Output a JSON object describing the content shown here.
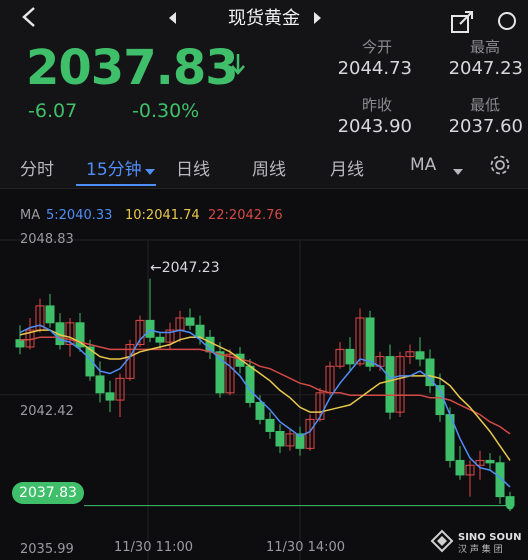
{
  "header": {
    "title": "现货黄金"
  },
  "quote": {
    "last": "2037.83",
    "direction": "down",
    "change": "-6.07",
    "change_pct": "-0.30%",
    "open_label": "今开",
    "open": "2044.73",
    "high_label": "最高",
    "high": "2047.23",
    "prev_close_label": "昨收",
    "prev_close": "2043.90",
    "low_label": "最低",
    "low": "2037.60"
  },
  "tabs": [
    {
      "label": "分时"
    },
    {
      "label": "15分钟"
    },
    {
      "label": "日线"
    },
    {
      "label": "周线"
    },
    {
      "label": "月线"
    },
    {
      "label": "MA"
    }
  ],
  "indicators": {
    "ma": "MA",
    "ma5": "5:2040.33",
    "ma10": "10:2041.74",
    "ma22": "22:2042.76"
  },
  "colors": {
    "up": "#3fbf6a",
    "down": "#e04848",
    "accent": "#4f8ef5",
    "ma5": "#4f8ef5",
    "ma10": "#e8c84a",
    "ma22": "#d24a46"
  },
  "chart_data": {
    "type": "candlestick",
    "y_ticks": [
      "2048.83",
      "2042.42",
      "2035.99"
    ],
    "x_ticks": [
      "11/30 11:00",
      "11/30 14:00"
    ],
    "ylim": [
      2035.99,
      2048.83
    ],
    "high_annotation": "←2047.23",
    "current_price_label": "2037.83",
    "candles": [
      [
        2044.7,
        2045.3,
        2044.1,
        2044.4
      ],
      [
        2044.4,
        2045.6,
        2044.3,
        2045.1
      ],
      [
        2045.1,
        2046.4,
        2045.0,
        2046.1
      ],
      [
        2046.1,
        2046.6,
        2045.2,
        2045.4
      ],
      [
        2045.4,
        2045.8,
        2044.3,
        2044.5
      ],
      [
        2044.5,
        2045.6,
        2044.0,
        2045.4
      ],
      [
        2045.4,
        2045.8,
        2044.2,
        2044.4
      ],
      [
        2044.4,
        2044.7,
        2043.0,
        2043.2
      ],
      [
        2043.2,
        2043.8,
        2042.1,
        2042.5
      ],
      [
        2042.5,
        2043.0,
        2041.7,
        2042.2
      ],
      [
        2042.2,
        2043.3,
        2041.5,
        2043.1
      ],
      [
        2043.1,
        2044.7,
        2043.0,
        2044.5
      ],
      [
        2044.5,
        2045.7,
        2044.4,
        2045.5
      ],
      [
        2045.5,
        2047.23,
        2044.6,
        2044.8
      ],
      [
        2044.8,
        2045.0,
        2044.3,
        2044.6
      ],
      [
        2044.6,
        2045.4,
        2044.3,
        2045.1
      ],
      [
        2045.1,
        2045.9,
        2044.6,
        2045.6
      ],
      [
        2045.6,
        2046.0,
        2045.1,
        2045.3
      ],
      [
        2045.3,
        2045.7,
        2044.5,
        2044.8
      ],
      [
        2044.8,
        2045.1,
        2043.9,
        2044.2
      ],
      [
        2044.2,
        2044.6,
        2042.3,
        2042.5
      ],
      [
        2042.5,
        2044.3,
        2042.4,
        2044.1
      ],
      [
        2044.1,
        2044.4,
        2043.3,
        2043.6
      ],
      [
        2043.6,
        2043.9,
        2041.9,
        2042.1
      ],
      [
        2042.1,
        2042.4,
        2041.2,
        2041.4
      ],
      [
        2041.4,
        2041.7,
        2040.6,
        2040.9
      ],
      [
        2040.9,
        2041.2,
        2040.0,
        2040.3
      ],
      [
        2040.3,
        2041.0,
        2040.1,
        2040.8
      ],
      [
        2040.8,
        2041.1,
        2039.9,
        2040.2
      ],
      [
        2040.2,
        2041.6,
        2040.1,
        2041.4
      ],
      [
        2041.4,
        2042.7,
        2041.3,
        2042.5
      ],
      [
        2042.5,
        2043.8,
        2042.4,
        2043.6
      ],
      [
        2043.6,
        2044.6,
        2043.5,
        2044.3
      ],
      [
        2044.3,
        2044.8,
        2043.4,
        2043.7
      ],
      [
        2043.7,
        2046.0,
        2043.6,
        2045.6
      ],
      [
        2045.6,
        2045.9,
        2043.4,
        2043.6
      ],
      [
        2043.6,
        2044.2,
        2043.4,
        2044.0
      ],
      [
        2044.0,
        2044.5,
        2041.4,
        2041.7
      ],
      [
        2041.7,
        2044.2,
        2041.5,
        2044.0
      ],
      [
        2044.0,
        2044.5,
        2043.7,
        2044.2
      ],
      [
        2044.2,
        2044.8,
        2043.6,
        2043.9
      ],
      [
        2043.9,
        2044.3,
        2042.5,
        2042.8
      ],
      [
        2042.8,
        2043.3,
        2041.3,
        2041.6
      ],
      [
        2041.6,
        2041.9,
        2039.4,
        2039.7
      ],
      [
        2039.7,
        2040.3,
        2038.9,
        2039.1
      ],
      [
        2039.1,
        2039.7,
        2038.2,
        2039.5
      ],
      [
        2039.5,
        2040.1,
        2038.9,
        2039.7
      ],
      [
        2039.7,
        2040.0,
        2039.3,
        2039.6
      ],
      [
        2039.6,
        2039.9,
        2037.9,
        2038.2
      ],
      [
        2038.2,
        2038.4,
        2037.6,
        2037.83
      ]
    ],
    "ma5": [
      2045.0,
      2045.2,
      2045.3,
      2045.1,
      2044.7,
      2044.6,
      2044.3,
      2043.9,
      2043.4,
      2043.3,
      2043.5,
      2044.0,
      2044.7,
      2045.1,
      2045.0,
      2045.0,
      2045.1,
      2045.0,
      2044.7,
      2044.3,
      2043.9,
      2043.6,
      2043.2,
      2042.6,
      2042.2,
      2041.8,
      2041.3,
      2041.0,
      2040.7,
      2040.9,
      2041.5,
      2042.3,
      2042.9,
      2043.4,
      2043.9,
      2043.8,
      2043.6,
      2043.1,
      2043.2,
      2043.2,
      2043.4,
      2043.1,
      2042.6,
      2041.6,
      2040.6,
      2039.8,
      2039.4,
      2039.3,
      2039.0,
      2038.6
    ],
    "ma10": [
      2044.9,
      2045.0,
      2045.1,
      2045.1,
      2044.9,
      2044.8,
      2044.6,
      2044.3,
      2044.0,
      2043.9,
      2043.9,
      2044.0,
      2044.2,
      2044.3,
      2044.4,
      2044.5,
      2044.7,
      2044.8,
      2044.8,
      2044.6,
      2044.4,
      2044.2,
      2043.9,
      2043.6,
      2043.3,
      2043.0,
      2042.6,
      2042.3,
      2041.9,
      2041.7,
      2041.7,
      2041.8,
      2041.9,
      2042.0,
      2042.3,
      2042.6,
      2042.9,
      2043.0,
      2043.1,
      2043.2,
      2043.2,
      2043.2,
      2043.1,
      2042.8,
      2042.3,
      2041.9,
      2041.4,
      2040.9,
      2040.3,
      2039.7
    ],
    "ma22": [
      2044.7,
      2044.7,
      2044.8,
      2044.8,
      2044.8,
      2044.7,
      2044.6,
      2044.5,
      2044.4,
      2044.3,
      2044.3,
      2044.3,
      2044.3,
      2044.3,
      2044.3,
      2044.3,
      2044.3,
      2044.3,
      2044.3,
      2044.2,
      2044.1,
      2044.0,
      2043.9,
      2043.8,
      2043.6,
      2043.5,
      2043.3,
      2043.1,
      2042.9,
      2042.8,
      2042.6,
      2042.5,
      2042.5,
      2042.4,
      2042.4,
      2042.4,
      2042.4,
      2042.4,
      2042.4,
      2042.4,
      2042.4,
      2042.3,
      2042.3,
      2042.2,
      2042.0,
      2041.8,
      2041.6,
      2041.3,
      2041.1,
      2040.8
    ]
  }
}
